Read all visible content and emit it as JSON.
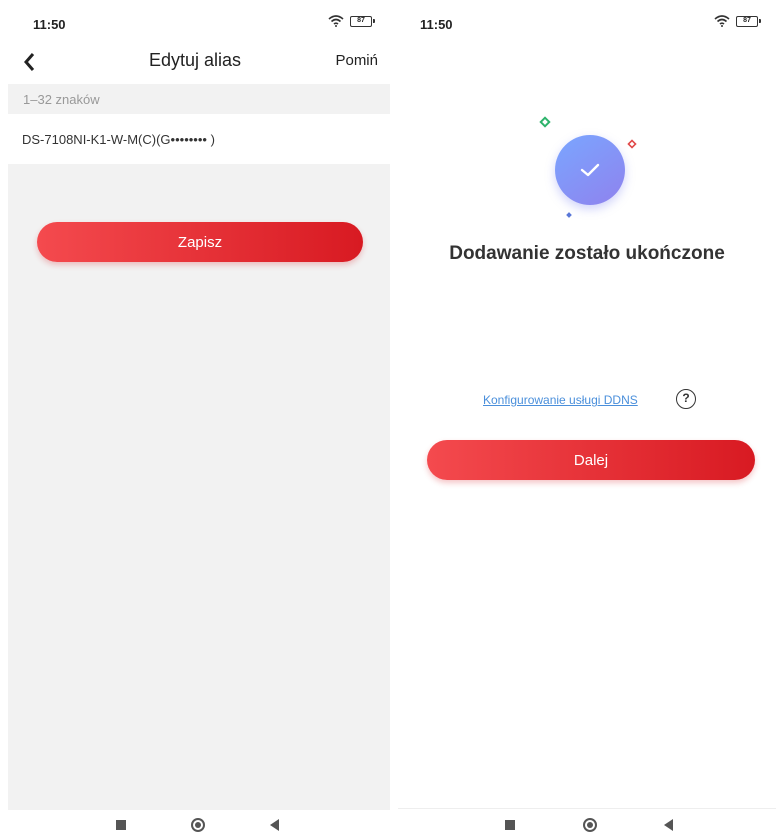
{
  "left_screen": {
    "status": {
      "time": "11:50",
      "battery": "87"
    },
    "header": {
      "title": "Edytuj alias",
      "skip_label": "Pomiń"
    },
    "alias_field": {
      "hint": "1–32 znaków",
      "value": "DS-7108NI-K1-W-M(C)(G•••••••• )"
    },
    "save_label": "Zapisz"
  },
  "right_screen": {
    "status": {
      "time": "11:50",
      "battery": "87"
    },
    "title": "Dodawanie zostało ukończone",
    "ddns_link": "Konfigurowanie usługi DDNS",
    "help_label": "?",
    "next_label": "Dalej"
  },
  "colors": {
    "accent_red_start": "#f44a4e",
    "accent_red_end": "#d81a22",
    "success_blue": "#7aa6ff",
    "success_purple": "#8f82ee",
    "link_blue": "#4a8fdb"
  },
  "icons": {
    "back": "back-chevron-icon",
    "wifi": "wifi-icon",
    "battery": "battery-icon",
    "success": "checkmark-icon",
    "help": "question-mark-icon",
    "nav_recent": "square-icon",
    "nav_home": "circle-icon",
    "nav_back": "triangle-back-icon"
  }
}
